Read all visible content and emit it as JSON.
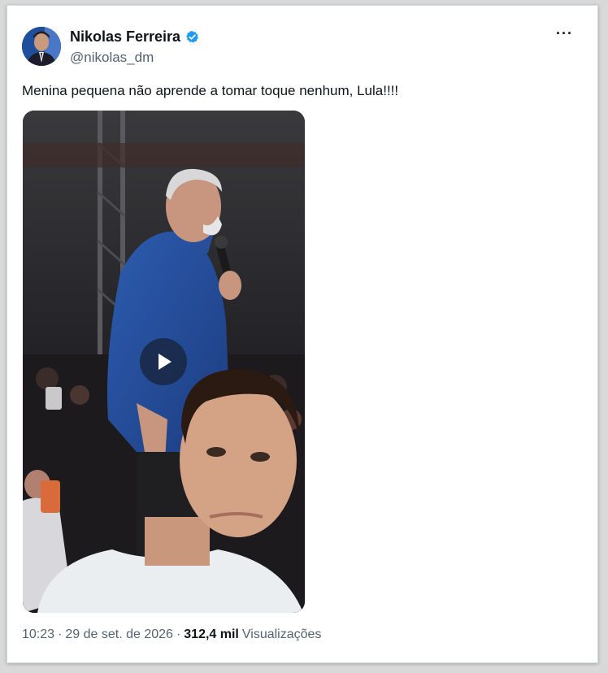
{
  "author": {
    "name": "Nikolas Ferreira",
    "handle": "@nikolas_dm",
    "verified_color": "#1d9bf0"
  },
  "menu": {
    "more_label": "···"
  },
  "tweet": {
    "text": "Menina pequena não aprende a tomar toque nenhum, Lula!!!!"
  },
  "media": {
    "type": "video",
    "play_icon": "play-icon"
  },
  "meta": {
    "time": "10:23",
    "sep1": "·",
    "date": "29 de set. de 2026",
    "sep2": "·",
    "views_count": "312,4 mil",
    "views_label": "Visualizações"
  },
  "colors": {
    "text_primary": "#0f1419",
    "text_secondary": "#536471",
    "border": "#cfd9de"
  }
}
